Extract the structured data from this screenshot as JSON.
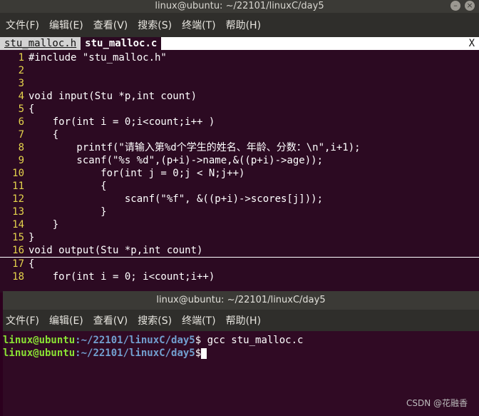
{
  "editor_window": {
    "title": "linux@ubuntu: ~/22101/linuxC/day5",
    "menu": [
      "文件(F)",
      "编辑(E)",
      "查看(V)",
      "搜索(S)",
      "终端(T)",
      "帮助(H)"
    ],
    "tabs": [
      {
        "label": "stu_malloc.h",
        "active": false
      },
      {
        "label": "stu_malloc.c",
        "active": true
      }
    ],
    "close_tab": "X",
    "lines": [
      {
        "n": "1",
        "text": "#include \"stu_malloc.h\""
      },
      {
        "n": "2",
        "text": ""
      },
      {
        "n": "3",
        "text": ""
      },
      {
        "n": "4",
        "text": "void input(Stu *p,int count)"
      },
      {
        "n": "5",
        "text": "{"
      },
      {
        "n": "6",
        "text": "    for(int i = 0;i<count;i++ )"
      },
      {
        "n": "7",
        "text": "    {"
      },
      {
        "n": "8",
        "text": "        printf(\"请输入第%d个学生的姓名、年龄、分数：\\n\",i+1);"
      },
      {
        "n": "9",
        "text": "        scanf(\"%s %d\",(p+i)->name,&((p+i)->age));"
      },
      {
        "n": "10",
        "text": "            for(int j = 0;j < N;j++)"
      },
      {
        "n": "11",
        "text": "            {"
      },
      {
        "n": "12",
        "text": "                scanf(\"%f\", &((p+i)->scores[j]));"
      },
      {
        "n": "13",
        "text": "            }"
      },
      {
        "n": "14",
        "text": "    }"
      },
      {
        "n": "15",
        "text": "}"
      },
      {
        "n": "16",
        "text": "void output(Stu *p,int count)"
      },
      {
        "n": "17",
        "text": "{"
      },
      {
        "n": "18",
        "text": "    for(int i = 0; i<count;i++)"
      }
    ]
  },
  "terminal_window": {
    "title": "linux@ubuntu: ~/22101/linuxC/day5",
    "menu": [
      "文件(F)",
      "编辑(E)",
      "查看(V)",
      "搜索(S)",
      "终端(T)",
      "帮助(H)"
    ],
    "lines": [
      {
        "user": "linux@ubuntu",
        "path": ":~/22101/linuxC/day5",
        "cmd": "$ gcc stu_malloc.c"
      },
      {
        "user": "linux@ubuntu",
        "path": ":~/22101/linuxC/day5",
        "cmd": "$"
      }
    ]
  },
  "watermark": "CSDN @花融香"
}
